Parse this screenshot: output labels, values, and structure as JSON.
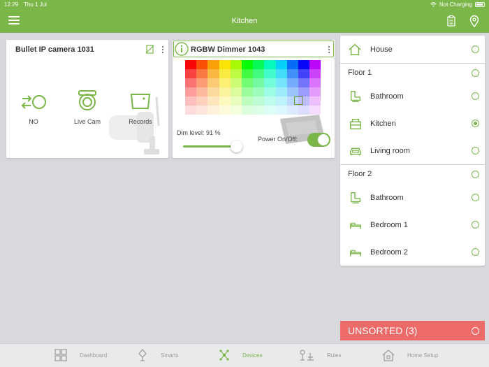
{
  "status": {
    "time": "12:29",
    "date": "Thu 1 Jul",
    "charging": "Not Charging"
  },
  "header": {
    "title": "Kitchen"
  },
  "camera_card": {
    "title": "Bullet IP camera 1031",
    "actions": [
      {
        "label": "NO",
        "icon": "swap-circle-icon"
      },
      {
        "label": "Live Cam",
        "icon": "dome-camera-icon"
      },
      {
        "label": "Records",
        "icon": "records-icon"
      }
    ]
  },
  "dimmer_card": {
    "title": "RGBW Dimmer 1043",
    "dim_label": "Dim level: 91 %",
    "dim_level": 0.91,
    "power_label": "Power On/Off:",
    "power_on": true
  },
  "rooms": {
    "house": {
      "label": "House"
    },
    "floor1": {
      "label": "Floor 1",
      "items": [
        {
          "label": "Bathroom",
          "icon": "bathroom-icon"
        },
        {
          "label": "Kitchen",
          "icon": "kitchen-icon",
          "selected": true
        },
        {
          "label": "Living room",
          "icon": "sofa-icon"
        }
      ]
    },
    "floor2": {
      "label": "Floor 2",
      "items": [
        {
          "label": "Bathroom",
          "icon": "bathroom-icon"
        },
        {
          "label": "Bedroom 1",
          "icon": "bed-icon"
        },
        {
          "label": "Bedroom 2",
          "icon": "bed-icon"
        }
      ]
    }
  },
  "unsorted": {
    "label": "UNSORTED (3)"
  },
  "nav": {
    "items": [
      {
        "label": "Dashboard"
      },
      {
        "label": "Smarts"
      },
      {
        "label": "Devices",
        "active": true
      },
      {
        "label": "Rules"
      },
      {
        "label": "Home Setup"
      }
    ]
  },
  "colors": {
    "accent": "#7ab648",
    "alert": "#ec6a68"
  }
}
